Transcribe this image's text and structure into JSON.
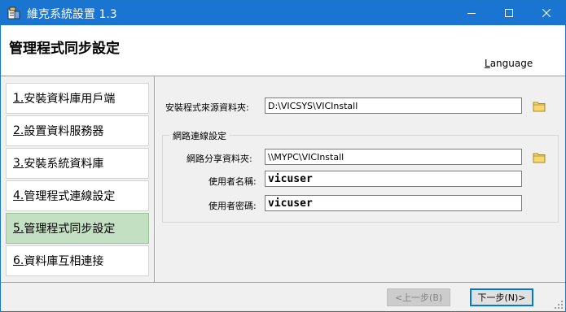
{
  "window": {
    "title": "維克系統設置 1.3",
    "titlebar_color": "#1a74d2"
  },
  "header": {
    "heading": "管理程式同步設定",
    "language_first": "L",
    "language_rest": "anguage"
  },
  "steps": [
    {
      "num": "1.",
      "label": "安裝資料庫用戶端",
      "active": false
    },
    {
      "num": "2.",
      "label": "設置資料服務器",
      "active": false
    },
    {
      "num": "3.",
      "label": "安裝系統資料庫",
      "active": false
    },
    {
      "num": "4.",
      "label": "管理程式連線設定",
      "active": false
    },
    {
      "num": "5.",
      "label": "管理程式同步設定",
      "active": true
    },
    {
      "num": "6.",
      "label": "資料庫互相連接",
      "active": false
    }
  ],
  "active_step_color": "#c3e0c3",
  "form": {
    "source_label": "安裝程式來源資料夾:",
    "source_value": "D:\\VICSYS\\VICInstall",
    "group_title": "網路連線設定",
    "share_label": "網路分享資料夾:",
    "share_value": "\\\\MYPC\\VICInstall",
    "user_label": "使用者名稱:",
    "user_value": "vicuser",
    "password_label": "使用者密碼:",
    "password_value": "vicuser"
  },
  "footer": {
    "prev_label": "<上一步(B)",
    "next_label": "下一步(N)>"
  },
  "icons": {
    "app": "app-icon",
    "minimize": "minimize-icon",
    "maximize": "maximize-icon",
    "close": "close-icon",
    "folder": "folder-icon",
    "grip": "resize-grip-icon"
  }
}
